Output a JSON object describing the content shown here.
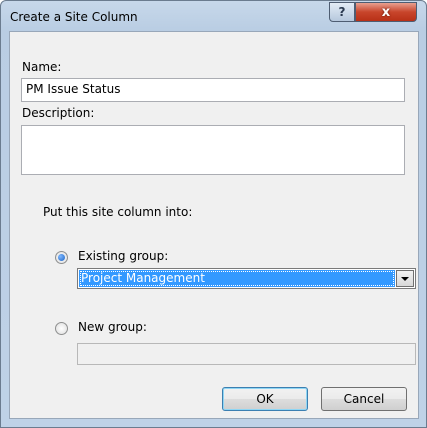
{
  "window": {
    "title": "Create a Site Column",
    "help_button": "?",
    "close_button": "x"
  },
  "form": {
    "name_label": "Name:",
    "name_value": "PM Issue Status",
    "description_label": "Description:",
    "description_value": "",
    "group_prompt": "Put this site column into:",
    "existing_group_label": "Existing group:",
    "existing_group_selected": true,
    "existing_group_value": "Project Management",
    "new_group_label": "New group:",
    "new_group_selected": false,
    "new_group_value": ""
  },
  "buttons": {
    "ok": "OK",
    "cancel": "Cancel"
  }
}
